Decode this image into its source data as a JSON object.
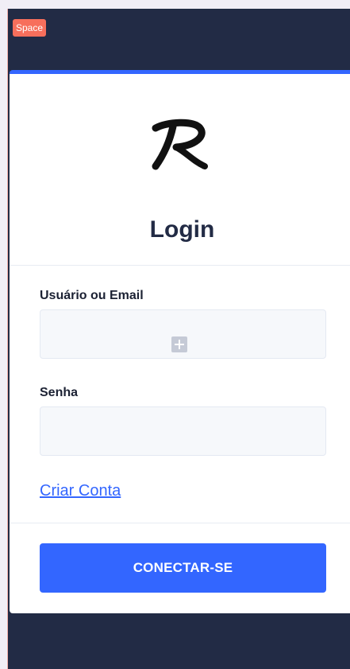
{
  "badge": {
    "label": "Space"
  },
  "login": {
    "title": "Login",
    "username_label": "Usuário ou Email",
    "username_value": "",
    "password_label": "Senha",
    "password_value": "",
    "create_account_link": "Criar Conta",
    "submit_label": "CONECTAR-SE"
  },
  "colors": {
    "accent": "#3366ff",
    "background": "#222b45",
    "badge": "#f76f5c"
  },
  "icons": {
    "logo": "r-logo-icon",
    "field_action": "plus-icon"
  }
}
